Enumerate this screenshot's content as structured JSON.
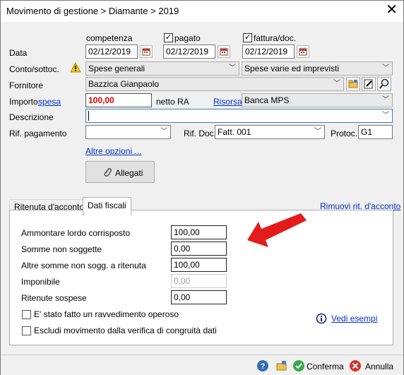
{
  "window": {
    "title": "Movimento di gestione > Diamante > 2019"
  },
  "date_row": {
    "label": "Data",
    "competenza_label": "competenza",
    "pagato_label": "pagato",
    "fattura_label": "fattura/doc.",
    "competenza_value": "02/12/2019",
    "pagato_value": "02/12/2019",
    "fattura_value": "02/12/2019",
    "pagato_checked": true,
    "fattura_checked": true
  },
  "conto": {
    "label": "Conto/sottoc.",
    "conto_value": "Spese generali",
    "sottoconto_value": "Spese varie ed imprevisti"
  },
  "fornitore": {
    "label": "Fornitore",
    "value": "Bazzica Gianpaolo"
  },
  "importo": {
    "label": "Importo",
    "link": "spesa",
    "value": "100,00",
    "netto_label": "netto RA",
    "risorsa_link": "Risorsa",
    "risorsa_value": "Banca MPS"
  },
  "descrizione": {
    "label": "Descrizione",
    "value": ""
  },
  "rif": {
    "label": "Rif. pagamento",
    "value": "",
    "doc_label": "Rif. Doc.",
    "doc_value": "Fatt. 001",
    "protoc_label": "Protoc.",
    "protoc_value": "G1"
  },
  "altre_opzioni": "Altre opzioni ...",
  "allegati_label": "Allegati",
  "tabs": [
    "Ritenuta d'acconto",
    "Dati fiscali"
  ],
  "rimuovi_link": "Rimuovi rit. d'acconto",
  "fiscal": [
    {
      "label": "Ammontare lordo corrisposto",
      "value": "100,00"
    },
    {
      "label": "Somme non soggette",
      "value": "0,00"
    },
    {
      "label": "Altre somme non sogg. a ritenuta",
      "value": "100,00"
    },
    {
      "label": "Imponibile",
      "value": "0,00"
    },
    {
      "label": "Ritenute sospese",
      "value": "0,00"
    }
  ],
  "checks": {
    "ravvedimento": "E' stato fatto un ravvedimento operoso",
    "escludi": "Escludi movimento dalla verifica di congruità dati"
  },
  "vedi_esempi": "Vedi esempi",
  "footer": {
    "conferma": "Conferma",
    "annulla": "Annulla"
  },
  "colors": {
    "accent_link": "#0033cc",
    "importo_red": "#e00000",
    "arrow_red": "#e31b1b",
    "focus_blue": "#3c7fb1"
  }
}
